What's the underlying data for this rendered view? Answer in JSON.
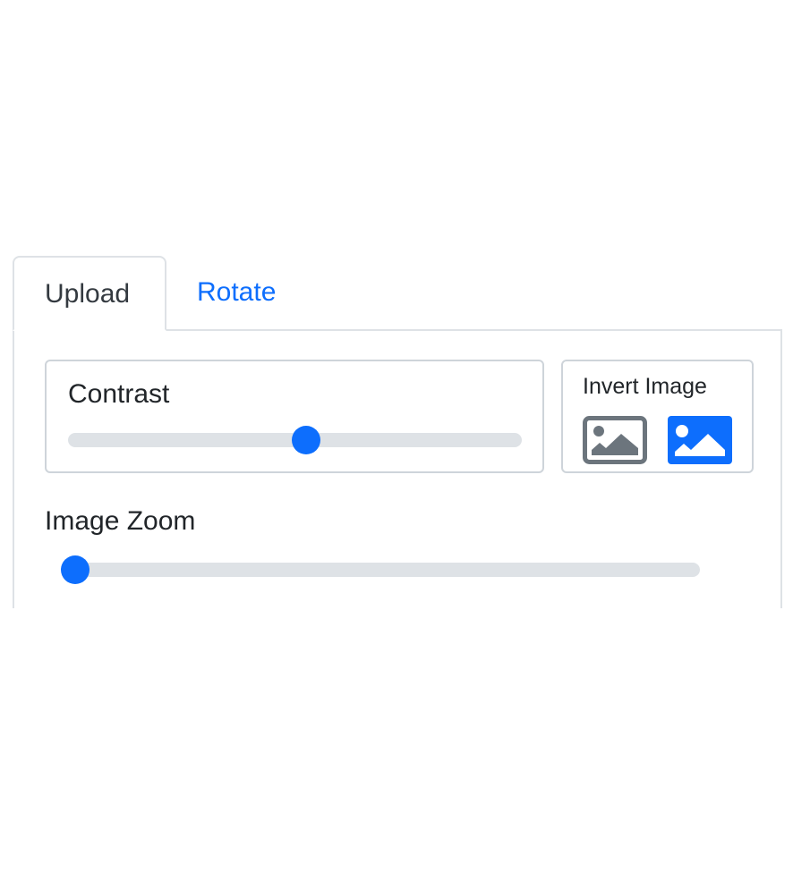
{
  "tabs": [
    {
      "label": "Upload",
      "active": true
    },
    {
      "label": "Rotate",
      "active": false
    }
  ],
  "contrast": {
    "label": "Contrast",
    "value_fraction": 0.525
  },
  "invert": {
    "label": "Invert Image",
    "options": [
      {
        "icon": "image-outline-icon",
        "selected": false
      },
      {
        "icon": "image-filled-icon",
        "selected": true
      }
    ]
  },
  "zoom": {
    "label": "Image Zoom",
    "value_fraction": 0.0
  },
  "colors": {
    "accent": "#0d6efd",
    "track": "#dee2e6",
    "border": "#ced4da",
    "icon_gray": "#6c757d",
    "text": "#212529"
  }
}
